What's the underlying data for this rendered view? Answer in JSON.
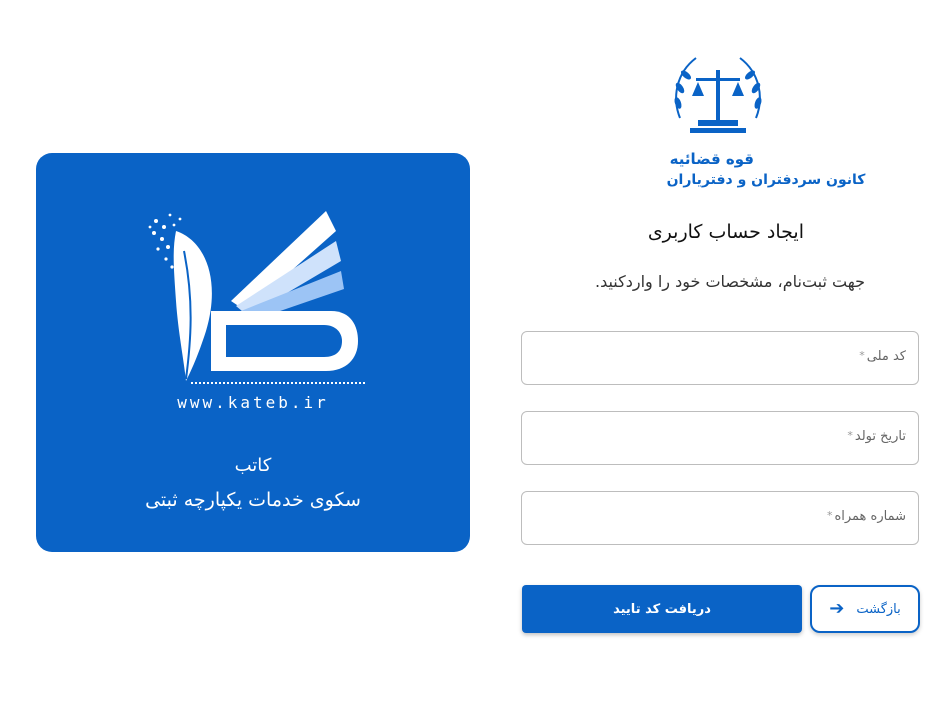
{
  "brand": {
    "url": "www.kateb.ir",
    "name": "کاتب",
    "tagline": "سکوی خدمات یکپارچه ثبتی",
    "color": "#0a63c6"
  },
  "org": {
    "line1": "قوه قضائیه",
    "line2": "کانون سردفتران و دفتریاران",
    "emblem_icon": "scales-of-justice-emblem"
  },
  "form": {
    "title": "ایجاد حساب کاربری",
    "subtitle": "جهت ثبت‌نام، مشخصات خود را واردکنید.",
    "fields": {
      "national_code": {
        "label": "کد ملی",
        "required": "*",
        "value": ""
      },
      "birth_date": {
        "label": "تاریخ تولد",
        "required": "*",
        "value": ""
      },
      "mobile": {
        "label": "شماره همراه",
        "required": "*",
        "value": ""
      }
    },
    "submit_label": "دریافت کد تایید",
    "back_label": "بازگشت",
    "back_icon": "arrow-right-icon"
  }
}
